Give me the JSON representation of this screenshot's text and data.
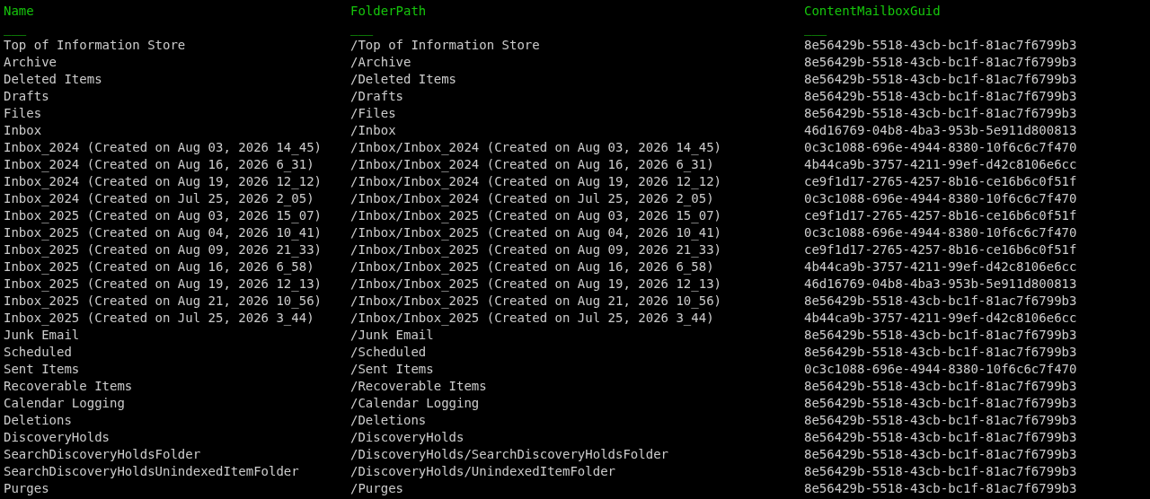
{
  "table": {
    "columns": [
      {
        "heading": "Name",
        "underline": "___"
      },
      {
        "heading": "FolderPath",
        "underline": "___"
      },
      {
        "heading": "ContentMailboxGuid",
        "underline": "___"
      }
    ],
    "rows": [
      [
        "Top of Information Store",
        "/Top of Information Store",
        "8e56429b-5518-43cb-bc1f-81ac7f6799b3"
      ],
      [
        "Archive",
        "/Archive",
        "8e56429b-5518-43cb-bc1f-81ac7f6799b3"
      ],
      [
        "Deleted Items",
        "/Deleted Items",
        "8e56429b-5518-43cb-bc1f-81ac7f6799b3"
      ],
      [
        "Drafts",
        "/Drafts",
        "8e56429b-5518-43cb-bc1f-81ac7f6799b3"
      ],
      [
        "Files",
        "/Files",
        "8e56429b-5518-43cb-bc1f-81ac7f6799b3"
      ],
      [
        "Inbox",
        "/Inbox",
        "46d16769-04b8-4ba3-953b-5e911d800813"
      ],
      [
        "Inbox_2024 (Created on Aug 03, 2026 14_45)",
        "/Inbox/Inbox_2024 (Created on Aug 03, 2026 14_45)",
        "0c3c1088-696e-4944-8380-10f6c6c7f470"
      ],
      [
        "Inbox_2024 (Created on Aug 16, 2026 6_31)",
        "/Inbox/Inbox_2024 (Created on Aug 16, 2026 6_31)",
        "4b44ca9b-3757-4211-99ef-d42c8106e6cc"
      ],
      [
        "Inbox_2024 (Created on Aug 19, 2026 12_12)",
        "/Inbox/Inbox_2024 (Created on Aug 19, 2026 12_12)",
        "ce9f1d17-2765-4257-8b16-ce16b6c0f51f"
      ],
      [
        "Inbox_2024 (Created on Jul 25, 2026 2_05)",
        "/Inbox/Inbox_2024 (Created on Jul 25, 2026 2_05)",
        "0c3c1088-696e-4944-8380-10f6c6c7f470"
      ],
      [
        "Inbox_2025 (Created on Aug 03, 2026 15_07)",
        "/Inbox/Inbox_2025 (Created on Aug 03, 2026 15_07)",
        "ce9f1d17-2765-4257-8b16-ce16b6c0f51f"
      ],
      [
        "Inbox_2025 (Created on Aug 04, 2026 10_41)",
        "/Inbox/Inbox_2025 (Created on Aug 04, 2026 10_41)",
        "0c3c1088-696e-4944-8380-10f6c6c7f470"
      ],
      [
        "Inbox_2025 (Created on Aug 09, 2026 21_33)",
        "/Inbox/Inbox_2025 (Created on Aug 09, 2026 21_33)",
        "ce9f1d17-2765-4257-8b16-ce16b6c0f51f"
      ],
      [
        "Inbox_2025 (Created on Aug 16, 2026 6_58)",
        "/Inbox/Inbox_2025 (Created on Aug 16, 2026 6_58)",
        "4b44ca9b-3757-4211-99ef-d42c8106e6cc"
      ],
      [
        "Inbox_2025 (Created on Aug 19, 2026 12_13)",
        "/Inbox/Inbox_2025 (Created on Aug 19, 2026 12_13)",
        "46d16769-04b8-4ba3-953b-5e911d800813"
      ],
      [
        "Inbox_2025 (Created on Aug 21, 2026 10_56)",
        "/Inbox/Inbox_2025 (Created on Aug 21, 2026 10_56)",
        "8e56429b-5518-43cb-bc1f-81ac7f6799b3"
      ],
      [
        "Inbox_2025 (Created on Jul 25, 2026 3_44)",
        "/Inbox/Inbox_2025 (Created on Jul 25, 2026 3_44)",
        "4b44ca9b-3757-4211-99ef-d42c8106e6cc"
      ],
      [
        "Junk Email",
        "/Junk Email",
        "8e56429b-5518-43cb-bc1f-81ac7f6799b3"
      ],
      [
        "Scheduled",
        "/Scheduled",
        "8e56429b-5518-43cb-bc1f-81ac7f6799b3"
      ],
      [
        "Sent Items",
        "/Sent Items",
        "0c3c1088-696e-4944-8380-10f6c6c7f470"
      ],
      [
        "Recoverable Items",
        "/Recoverable Items",
        "8e56429b-5518-43cb-bc1f-81ac7f6799b3"
      ],
      [
        "Calendar Logging",
        "/Calendar Logging",
        "8e56429b-5518-43cb-bc1f-81ac7f6799b3"
      ],
      [
        "Deletions",
        "/Deletions",
        "8e56429b-5518-43cb-bc1f-81ac7f6799b3"
      ],
      [
        "DiscoveryHolds",
        "/DiscoveryHolds",
        "8e56429b-5518-43cb-bc1f-81ac7f6799b3"
      ],
      [
        "SearchDiscoveryHoldsFolder",
        "/DiscoveryHolds/SearchDiscoveryHoldsFolder",
        "8e56429b-5518-43cb-bc1f-81ac7f6799b3"
      ],
      [
        "SearchDiscoveryHoldsUnindexedItemFolder",
        "/DiscoveryHolds/UnindexedItemFolder",
        "8e56429b-5518-43cb-bc1f-81ac7f6799b3"
      ],
      [
        "Purges",
        "/Purges",
        "8e56429b-5518-43cb-bc1f-81ac7f6799b3"
      ]
    ]
  }
}
